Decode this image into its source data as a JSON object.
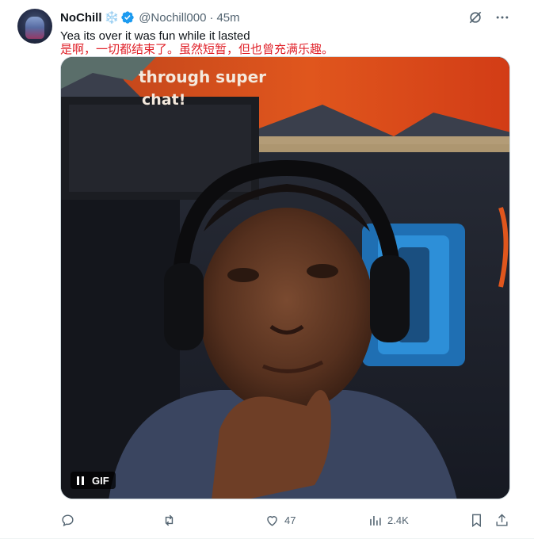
{
  "tweet": {
    "author_name": "NoChill",
    "name_emoji": "❄️",
    "handle": "@Nochill000",
    "separator": "·",
    "time": "45m",
    "text_en": "Yea its over it was fun while it lasted",
    "text_cn": "是啊，一切都结束了。虽然短暂，但也曾充满乐趣。"
  },
  "media": {
    "overlay_text_line1": "through super",
    "overlay_text_line2": "chat!",
    "badge_label": "GIF"
  },
  "actions": {
    "replies": "",
    "retweets": "",
    "likes": "47",
    "views": "2.4K"
  },
  "colors": {
    "text": "#0f1419",
    "muted": "#536471",
    "translation": "#e0222a",
    "verified": "#1d9bf0"
  }
}
